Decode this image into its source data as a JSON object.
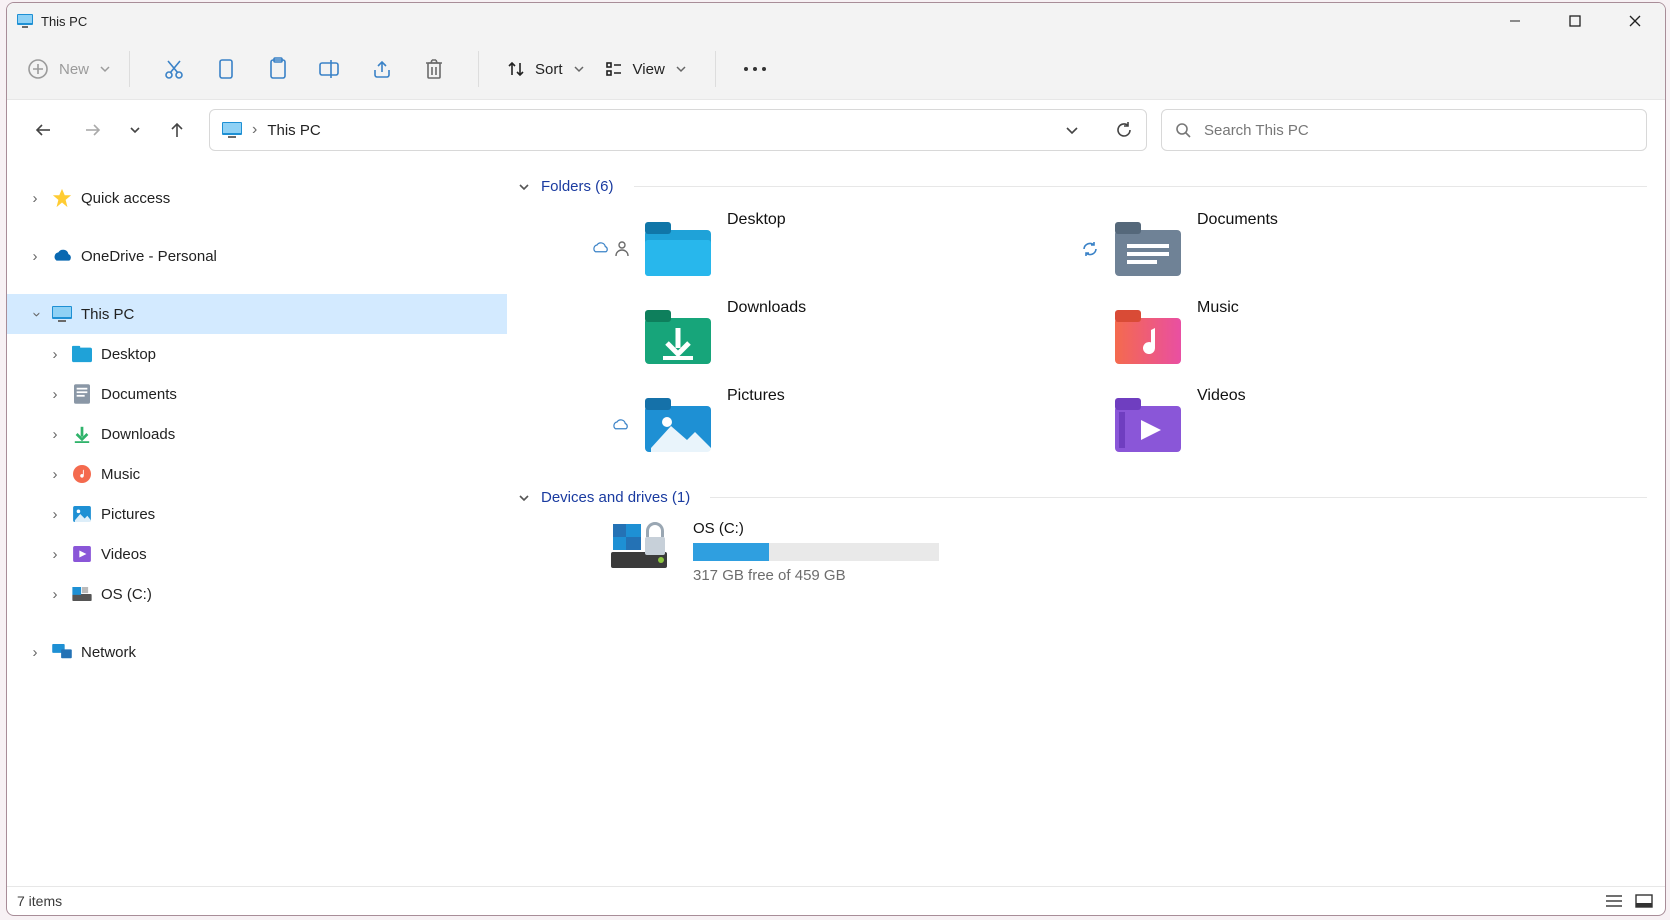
{
  "window": {
    "title": "This PC"
  },
  "toolbar": {
    "new_label": "New",
    "sort_label": "Sort",
    "view_label": "View"
  },
  "address": {
    "crumb": "This PC"
  },
  "search": {
    "placeholder": "Search This PC"
  },
  "sidebar": {
    "quick_access": "Quick access",
    "onedrive": "OneDrive - Personal",
    "this_pc": "This PC",
    "children": {
      "desktop": "Desktop",
      "documents": "Documents",
      "downloads": "Downloads",
      "music": "Music",
      "pictures": "Pictures",
      "videos": "Videos",
      "osc": "OS (C:)"
    },
    "network": "Network"
  },
  "groups": {
    "folders_label": "Folders (6)",
    "drives_label": "Devices and drives (1)"
  },
  "folders": {
    "desktop": "Desktop",
    "documents": "Documents",
    "downloads": "Downloads",
    "music": "Music",
    "pictures": "Pictures",
    "videos": "Videos"
  },
  "drive": {
    "name": "OS (C:)",
    "free_text": "317 GB free of 459 GB"
  },
  "status": {
    "count_text": "7 items"
  }
}
